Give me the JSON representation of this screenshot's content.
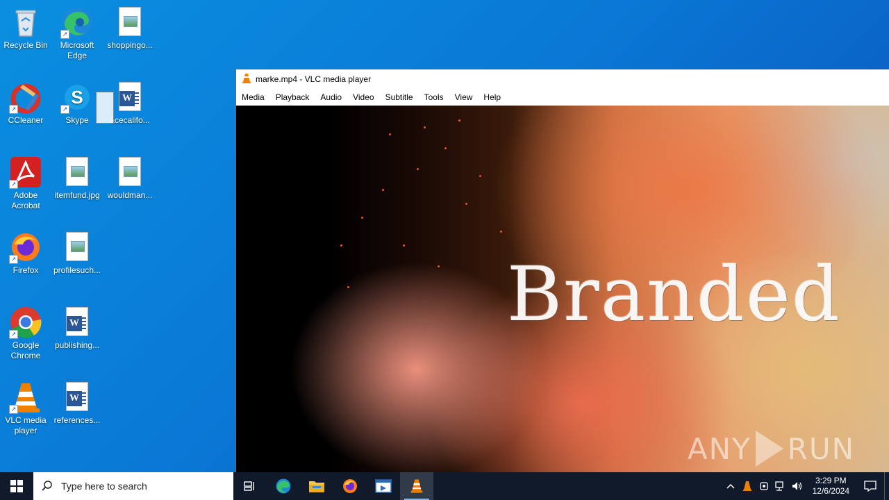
{
  "desktop": {
    "icons": [
      {
        "label": "Recycle Bin"
      },
      {
        "label": "Microsoft Edge"
      },
      {
        "label": "shoppingo..."
      },
      {
        "label": "CCleaner"
      },
      {
        "label": "Skype"
      },
      {
        "label": "acecalifo..."
      },
      {
        "label": "Adobe Acrobat"
      },
      {
        "label": "itemfund.jpg"
      },
      {
        "label": "wouldman..."
      },
      {
        "label": "Firefox"
      },
      {
        "label": "profilesuch..."
      },
      {
        "label": "Google Chrome"
      },
      {
        "label": "publishing..."
      },
      {
        "label": "VLC media player"
      },
      {
        "label": "references..."
      }
    ]
  },
  "vlc": {
    "title": "marke.mp4 - VLC media player",
    "menu": [
      "Media",
      "Playback",
      "Audio",
      "Video",
      "Subtitle",
      "Tools",
      "View",
      "Help"
    ],
    "video_text": "Branded",
    "watermark_left": "ANY",
    "watermark_right": "RUN"
  },
  "taskbar": {
    "search_placeholder": "Type here to search",
    "apps": [
      "task-view",
      "edge",
      "file-explorer",
      "firefox",
      "remote-app",
      "vlc"
    ],
    "active_app": "vlc",
    "clock_time": "3:29 PM",
    "clock_date": "12/6/2024"
  },
  "colors": {
    "taskbar_bg": "#101a2a",
    "vlc_orange": "#f08000",
    "desktop_blue": "#0a78d6"
  }
}
